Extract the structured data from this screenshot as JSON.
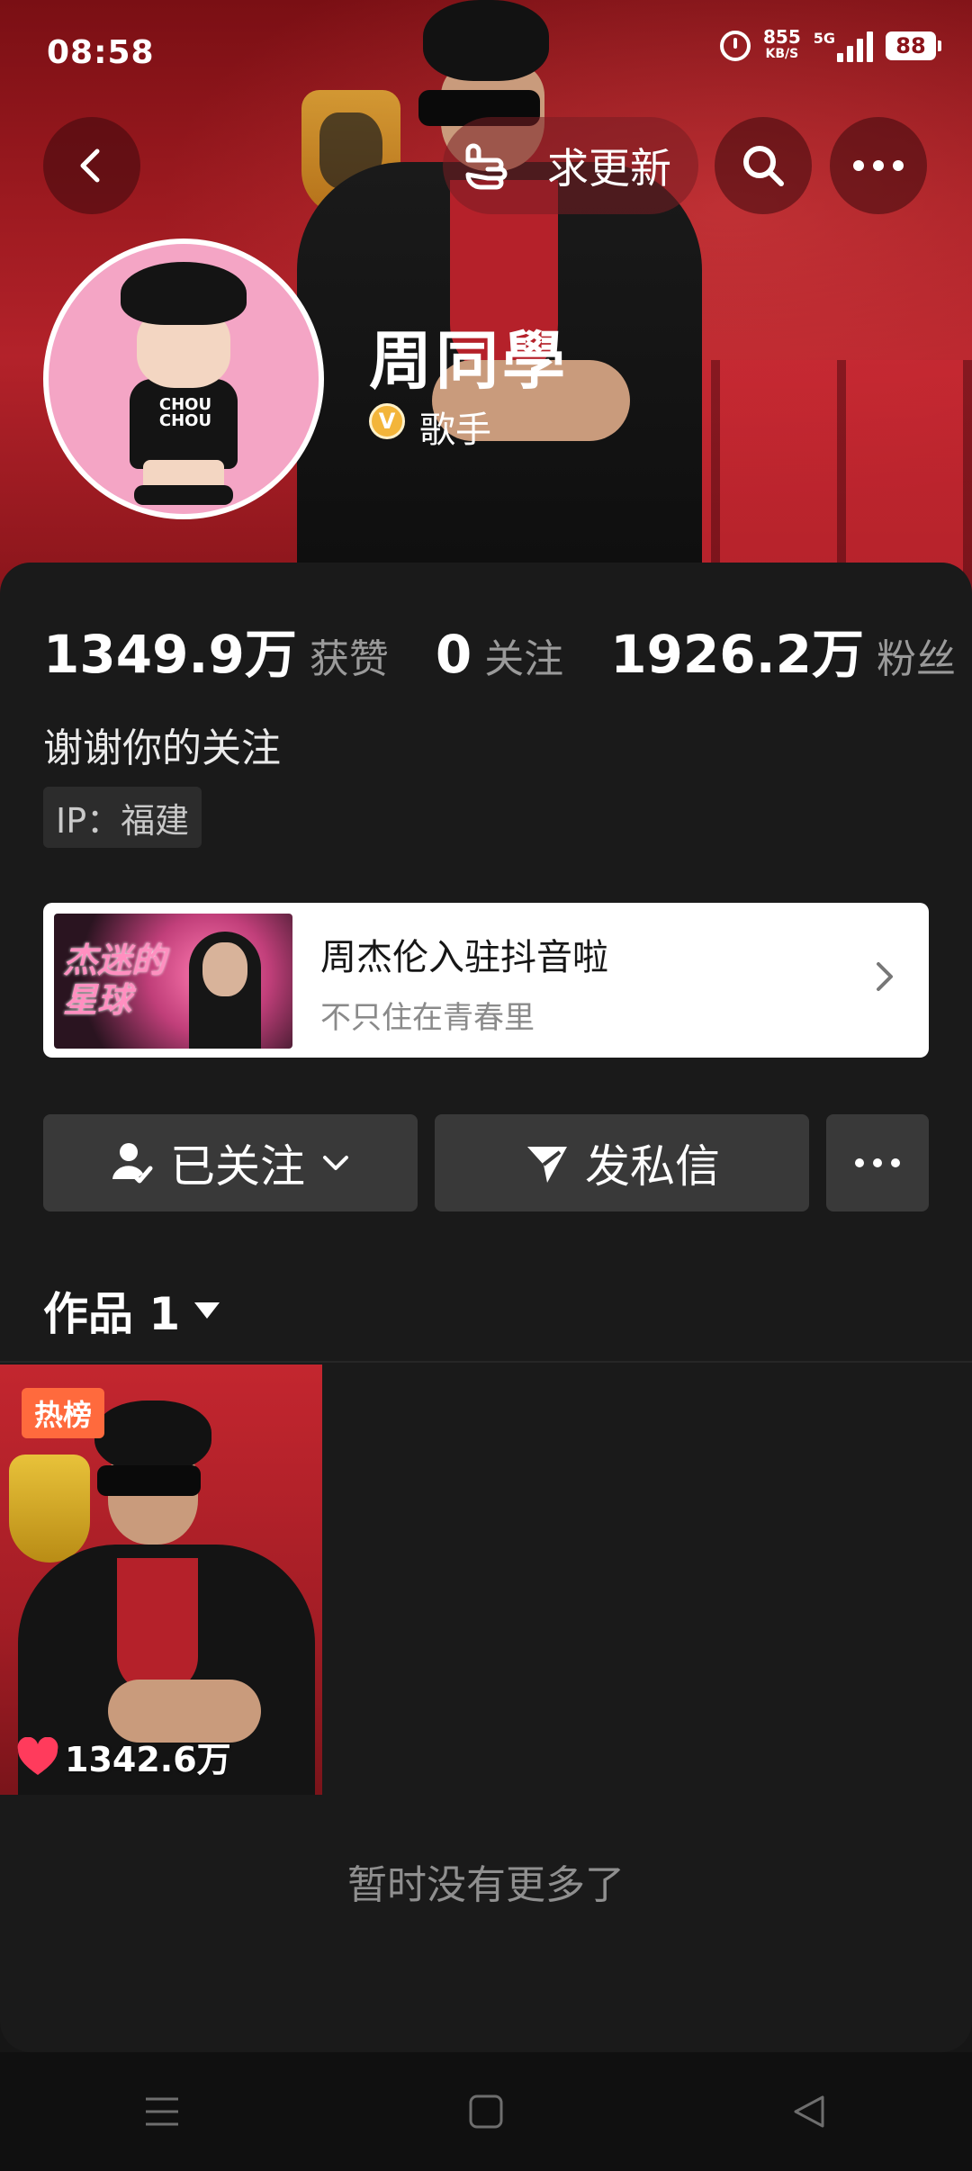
{
  "status_bar": {
    "time": "08:58",
    "net_speed": "855",
    "net_unit": "KB/S",
    "network": "5G",
    "battery": "88"
  },
  "header": {
    "request_update_label": "求更新",
    "back_icon": "chevron-left-icon",
    "search_icon": "search-icon",
    "more_icon": "more-icon"
  },
  "profile": {
    "name": "周同學",
    "verify_badge": "V",
    "verify_label": "歌手",
    "stats": [
      {
        "value": "1349.9万",
        "label": "获赞"
      },
      {
        "value": "0",
        "label": "关注"
      },
      {
        "value": "1926.2万",
        "label": "粉丝"
      }
    ],
    "bio": "谢谢你的关注",
    "ip": "IP：福建"
  },
  "avatar_text": "CHOU CHOU",
  "banner": {
    "image_text": "杰迷的星球",
    "title": "周杰伦入驻抖音啦",
    "subtitle": "不只住在青春里"
  },
  "actions": {
    "follow_label": "已关注",
    "message_label": "发私信"
  },
  "works": {
    "tab_label": "作品 1",
    "items": [
      {
        "badge": "热榜",
        "likes": "1342.6万"
      }
    ],
    "end_text": "暂时没有更多了"
  },
  "colors": {
    "background": "#161616",
    "card": "#1a1a1a",
    "button": "#393939",
    "hot_badge": "#ff6a3d",
    "verify": "#f3b53a",
    "like_heart": "#ff3b5c"
  }
}
